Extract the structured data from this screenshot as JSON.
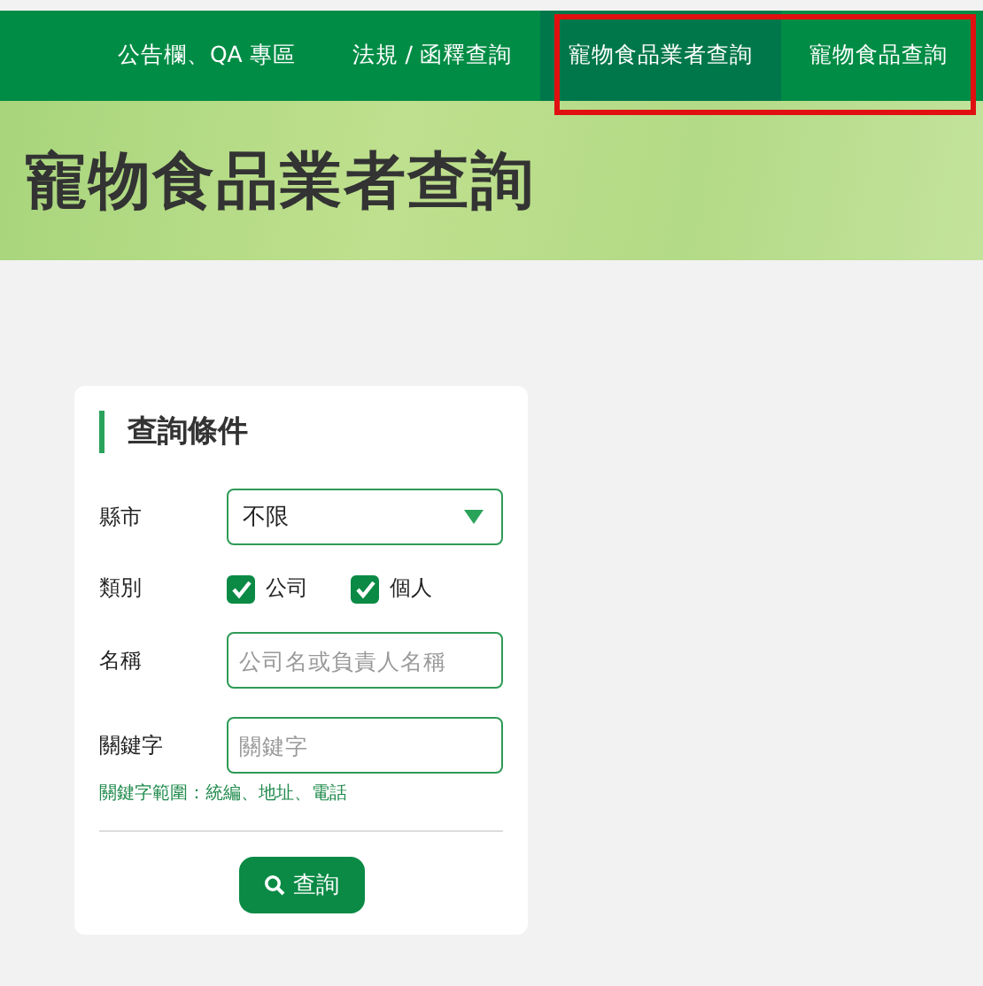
{
  "nav": {
    "items": [
      {
        "label": "公告欄、QA 專區",
        "selected": false,
        "highlighted": false
      },
      {
        "label": "法規 / 函釋查詢",
        "selected": false,
        "highlighted": false
      },
      {
        "label": "寵物食品業者查詢",
        "selected": true,
        "highlighted": true
      },
      {
        "label": "寵物食品查詢",
        "selected": false,
        "highlighted": true
      }
    ]
  },
  "banner": {
    "title": "寵物食品業者查詢"
  },
  "form": {
    "title": "查詢條件",
    "county": {
      "label": "縣市",
      "value": "不限"
    },
    "category": {
      "label": "類別",
      "options": [
        {
          "label": "公司",
          "checked": true
        },
        {
          "label": "個人",
          "checked": true
        }
      ]
    },
    "name": {
      "label": "名稱",
      "placeholder": "公司名或負責人名稱"
    },
    "keyword": {
      "label": "關鍵字",
      "placeholder": "關鍵字"
    },
    "hint": "關鍵字範圍：統編、地址、電話",
    "submit": "查詢"
  }
}
